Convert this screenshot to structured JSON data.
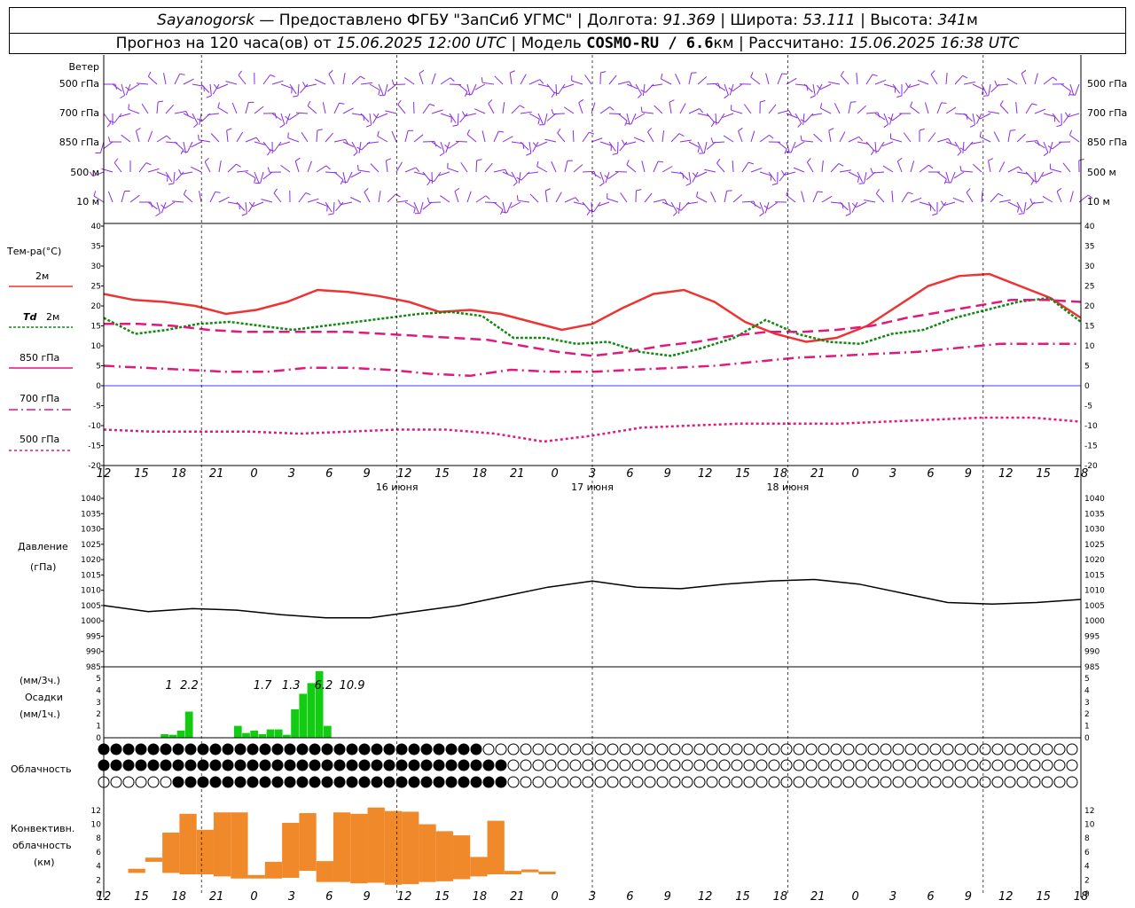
{
  "header": {
    "station": "Sayanogorsk",
    "dash": "—",
    "provider": "Предоставлено ФГБУ \"ЗапСиб УГМС\"",
    "lon_label": "Долгота:",
    "lon": "91.369",
    "lat_label": "Широта:",
    "lat": "53.111",
    "alt_label": "Высота:",
    "alt": "341",
    "alt_unit": "м",
    "forecast_label": "Прогноз на 120 часа(ов) от",
    "forecast_start": "15.06.2025 12:00 UTC",
    "model_label": "Модель",
    "model": "COSMO-RU / 6.6",
    "model_unit": "км",
    "calc_label": "Рассчитано:",
    "calc_time": "15.06.2025 16:38 UTC",
    "sep": "|"
  },
  "labels": {
    "wind": "Ветер",
    "wind_levels": [
      "500 гПа",
      "700 гПа",
      "850 гПа",
      "500 м",
      "10 м"
    ],
    "temp": "Тем-ра(°С)",
    "t2m": "2м",
    "td": "Td",
    "td_unit": "2м",
    "t850": "850 гПа",
    "t700": "700 гПа",
    "t500": "500 гПа",
    "pressure": "Давление",
    "pressure_unit": "(гПа)",
    "precip_unit3": "(мм/3ч.)",
    "precip": "Осадки",
    "precip_unit1": "(мм/1ч.)",
    "clouds": "Облачность",
    "conv1": "Конвективн.",
    "conv2": "облачность",
    "conv3": "(км)"
  },
  "x_axis": {
    "ticks": [
      "12",
      "15",
      "18",
      "21",
      "0",
      "3",
      "6",
      "9",
      "12",
      "15",
      "18",
      "21",
      "0",
      "3",
      "6",
      "9",
      "12",
      "15",
      "18",
      "21",
      "0",
      "3",
      "6",
      "9",
      "12",
      "15",
      "18"
    ],
    "days": [
      "16 июня",
      "17 июня",
      "18 июня"
    ]
  },
  "colors": {
    "wind": "#8a2be2",
    "t2m": "#ee3333",
    "td": "#118811",
    "t850": "#e0197d",
    "t700": "#e0197d",
    "t500": "#e0197d",
    "zero": "#0000ff",
    "precip": "#11cc11",
    "conv": "#f0892a"
  },
  "chart_data": [
    {
      "type": "line",
      "name": "temperature",
      "ylim": [
        -20,
        40
      ],
      "yticks": [
        "-20",
        "-15",
        "-10",
        "-5",
        "0",
        "5",
        "10",
        "15",
        "20",
        "25",
        "30",
        "35",
        "40"
      ],
      "x_hours": [
        0,
        3,
        6,
        9,
        12,
        15,
        18,
        21,
        24,
        27,
        30,
        33,
        36,
        39,
        42,
        45,
        48,
        51,
        54,
        57,
        60,
        63,
        66,
        69,
        72,
        75,
        78
      ],
      "series": [
        {
          "name": "2м",
          "values": [
            23,
            21.5,
            21,
            20,
            18,
            19,
            21,
            24,
            23.5,
            22.5,
            21,
            18.5,
            19,
            18,
            16,
            14,
            15.5,
            19.5,
            23,
            24,
            21,
            16,
            13,
            11,
            12,
            15,
            20,
            25,
            27.5,
            28,
            25,
            22,
            17
          ]
        },
        {
          "name": "Td 2м",
          "values": [
            17,
            13,
            14,
            15.5,
            16,
            15,
            14,
            15,
            16,
            17,
            18,
            18.5,
            17.5,
            12,
            12,
            10.5,
            11,
            8.5,
            7.5,
            9.5,
            12,
            16.5,
            13,
            11,
            10.5,
            13,
            14,
            17,
            19,
            21,
            22,
            16
          ]
        },
        {
          "name": "850 гПа",
          "values": [
            15.5,
            15.5,
            15,
            14,
            13.5,
            13.5,
            13.5,
            13.5,
            13,
            12.5,
            12,
            11.5,
            10,
            8.5,
            7.5,
            8.5,
            10,
            11,
            12.5,
            13.5,
            13.5,
            14,
            15,
            17,
            18.5,
            20,
            21.5,
            21.5,
            21
          ]
        },
        {
          "name": "700 гПа",
          "values": [
            5,
            4.5,
            4,
            3.5,
            3.5,
            4.5,
            4.5,
            4,
            3,
            2.5,
            4,
            3.5,
            3.5,
            4,
            4.5,
            5,
            6,
            7,
            7.5,
            8,
            8.5,
            9.5,
            10.5,
            10.5,
            10.5
          ]
        },
        {
          "name": "500 гПа",
          "values": [
            -11,
            -11.5,
            -11.5,
            -11.5,
            -12,
            -11.5,
            -11,
            -11,
            -12,
            -14,
            -12.5,
            -10.5,
            -10,
            -9.5,
            -9.5,
            -9.5,
            -9,
            -8.5,
            -8,
            -8,
            -9
          ]
        }
      ]
    },
    {
      "type": "line",
      "name": "pressure",
      "ylim": [
        985,
        1040
      ],
      "yticks": [
        "985",
        "990",
        "995",
        "1000",
        "1005",
        "1010",
        "1015",
        "1020",
        "1025",
        "1030",
        "1035",
        "1040"
      ],
      "values": [
        1005,
        1003,
        1004,
        1003.5,
        1002,
        1001,
        1001,
        1003,
        1005,
        1008,
        1011,
        1013,
        1011,
        1010.5,
        1012,
        1013,
        1013.5,
        1012,
        1009,
        1006,
        1005.5,
        1006,
        1007
      ]
    },
    {
      "type": "bar",
      "name": "precipitation",
      "ylim": [
        0,
        5
      ],
      "yticks": [
        "0",
        "1",
        "2",
        "3",
        "4",
        "5"
      ],
      "labels": [
        "1",
        "2.2",
        "1.7",
        "1.3",
        "6.2",
        "10.9"
      ],
      "values": [
        0.3,
        0.25,
        0.6,
        2.2,
        0,
        0,
        0,
        0,
        0,
        1,
        0.4,
        0.6,
        0.3,
        0.7,
        0.7,
        0.25,
        2.4,
        3.7,
        4.6,
        5.6,
        1
      ]
    },
    {
      "type": "bar",
      "name": "convective clouds",
      "ylim": [
        0,
        13
      ],
      "yticks": [
        "0",
        "2",
        "4",
        "6",
        "8",
        "10",
        "12"
      ],
      "ranges": [
        [
          3,
          3.6
        ],
        [
          4.6,
          5.2
        ],
        [
          3,
          8.8
        ],
        [
          2.8,
          11.5
        ],
        [
          2.8,
          9.2
        ],
        [
          2.5,
          11.7
        ],
        [
          2.2,
          11.7
        ],
        [
          2.2,
          2.7
        ],
        [
          2.2,
          4.6
        ],
        [
          2.3,
          10.2
        ],
        [
          3.3,
          11.6
        ],
        [
          1.7,
          4.7
        ],
        [
          1.7,
          11.7
        ],
        [
          1.5,
          11.5
        ],
        [
          1.6,
          12.4
        ],
        [
          1.3,
          11.9
        ],
        [
          1.4,
          11.8
        ],
        [
          1.7,
          10
        ],
        [
          1.8,
          9
        ],
        [
          2.1,
          8.4
        ],
        [
          2.5,
          5.3
        ],
        [
          2.8,
          10.5
        ],
        [
          2.8,
          3.3
        ],
        [
          3.1,
          3.5
        ],
        [
          3.2,
          2.8
        ]
      ]
    }
  ]
}
